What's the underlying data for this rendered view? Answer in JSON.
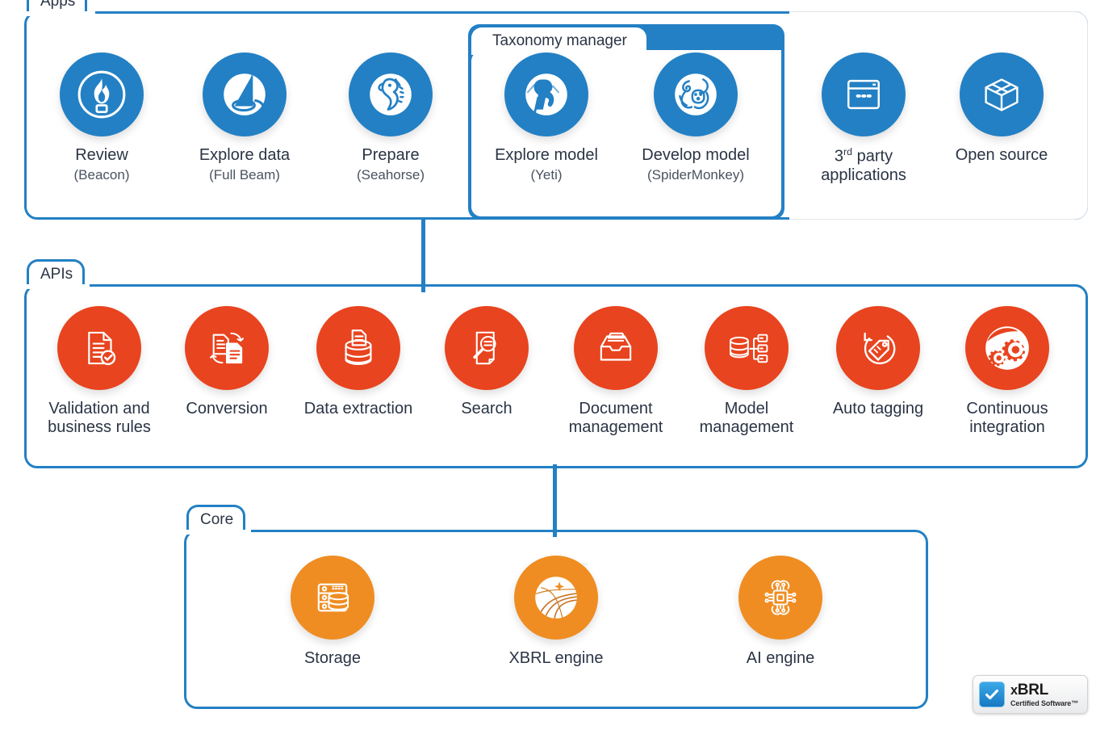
{
  "diagram": {
    "colors": {
      "apps": "#2380C4",
      "apis": "#E8441F",
      "core": "#EF8D22",
      "frame_border": "#2380C4",
      "soft_frame": "#e3e6ea",
      "text": "#2b3445"
    }
  },
  "groups": {
    "apps": {
      "label": "Apps"
    },
    "taxonomy": {
      "label": "Taxonomy manager"
    },
    "apis": {
      "label": "APIs"
    },
    "core": {
      "label": "Core"
    }
  },
  "apps": {
    "items": [
      {
        "label": "Review",
        "sub": "(Beacon)",
        "icon": "beacon-flame-icon",
        "tm": true
      },
      {
        "label": "Explore data",
        "sub": "(Full Beam)",
        "icon": "full-beam-light-icon",
        "tm": true
      },
      {
        "label": "Prepare",
        "sub": "(Seahorse)",
        "icon": "seahorse-icon",
        "tm": true
      }
    ]
  },
  "taxonomy": {
    "items": [
      {
        "label": "Explore model",
        "sub": "(Yeti)",
        "icon": "yeti-icon",
        "tm": true
      },
      {
        "label": "Develop model",
        "sub": "(SpiderMonkey)",
        "icon": "spidermonkey-icon",
        "tm": true
      }
    ]
  },
  "external": {
    "items": [
      {
        "label_html": "3<sup>rd</sup> party",
        "label2": "applications",
        "icon": "browser-window-icon",
        "tm": false
      },
      {
        "label_html": "Open source",
        "label2": "",
        "icon": "open-box-icon",
        "tm": false
      }
    ]
  },
  "apis": {
    "items": [
      {
        "label": "Validation and",
        "label2": "business rules",
        "icon": "document-check-icon",
        "tm": false
      },
      {
        "label": "Conversion",
        "label2": "",
        "icon": "documents-convert-icon",
        "tm": false
      },
      {
        "label": "Data extraction",
        "label2": "",
        "icon": "database-document-icon",
        "tm": false
      },
      {
        "label": "Search",
        "label2": "",
        "icon": "document-search-icon",
        "tm": false
      },
      {
        "label": "Document",
        "label2": "management",
        "icon": "file-tray-icon",
        "tm": false
      },
      {
        "label": "Model",
        "label2": "management",
        "icon": "database-nodes-icon",
        "tm": false
      },
      {
        "label": "Auto tagging",
        "label2": "",
        "icon": "tag-refresh-icon",
        "tm": false
      },
      {
        "label": "Continuous",
        "label2": "integration",
        "icon": "gears-icon",
        "tm": true
      }
    ]
  },
  "core": {
    "items": [
      {
        "label": "Storage",
        "icon": "server-database-icon",
        "tm": false
      },
      {
        "label": "XBRL engine",
        "icon": "xbrl-road-icon",
        "tm": true
      },
      {
        "label": "AI engine",
        "icon": "ai-chip-icon",
        "tm": false
      }
    ]
  },
  "certification": {
    "brand_low": "x",
    "brand_high": "BRL",
    "caption": "Certified Software™",
    "check_icon": "check-icon"
  },
  "trademark_symbol": "™"
}
